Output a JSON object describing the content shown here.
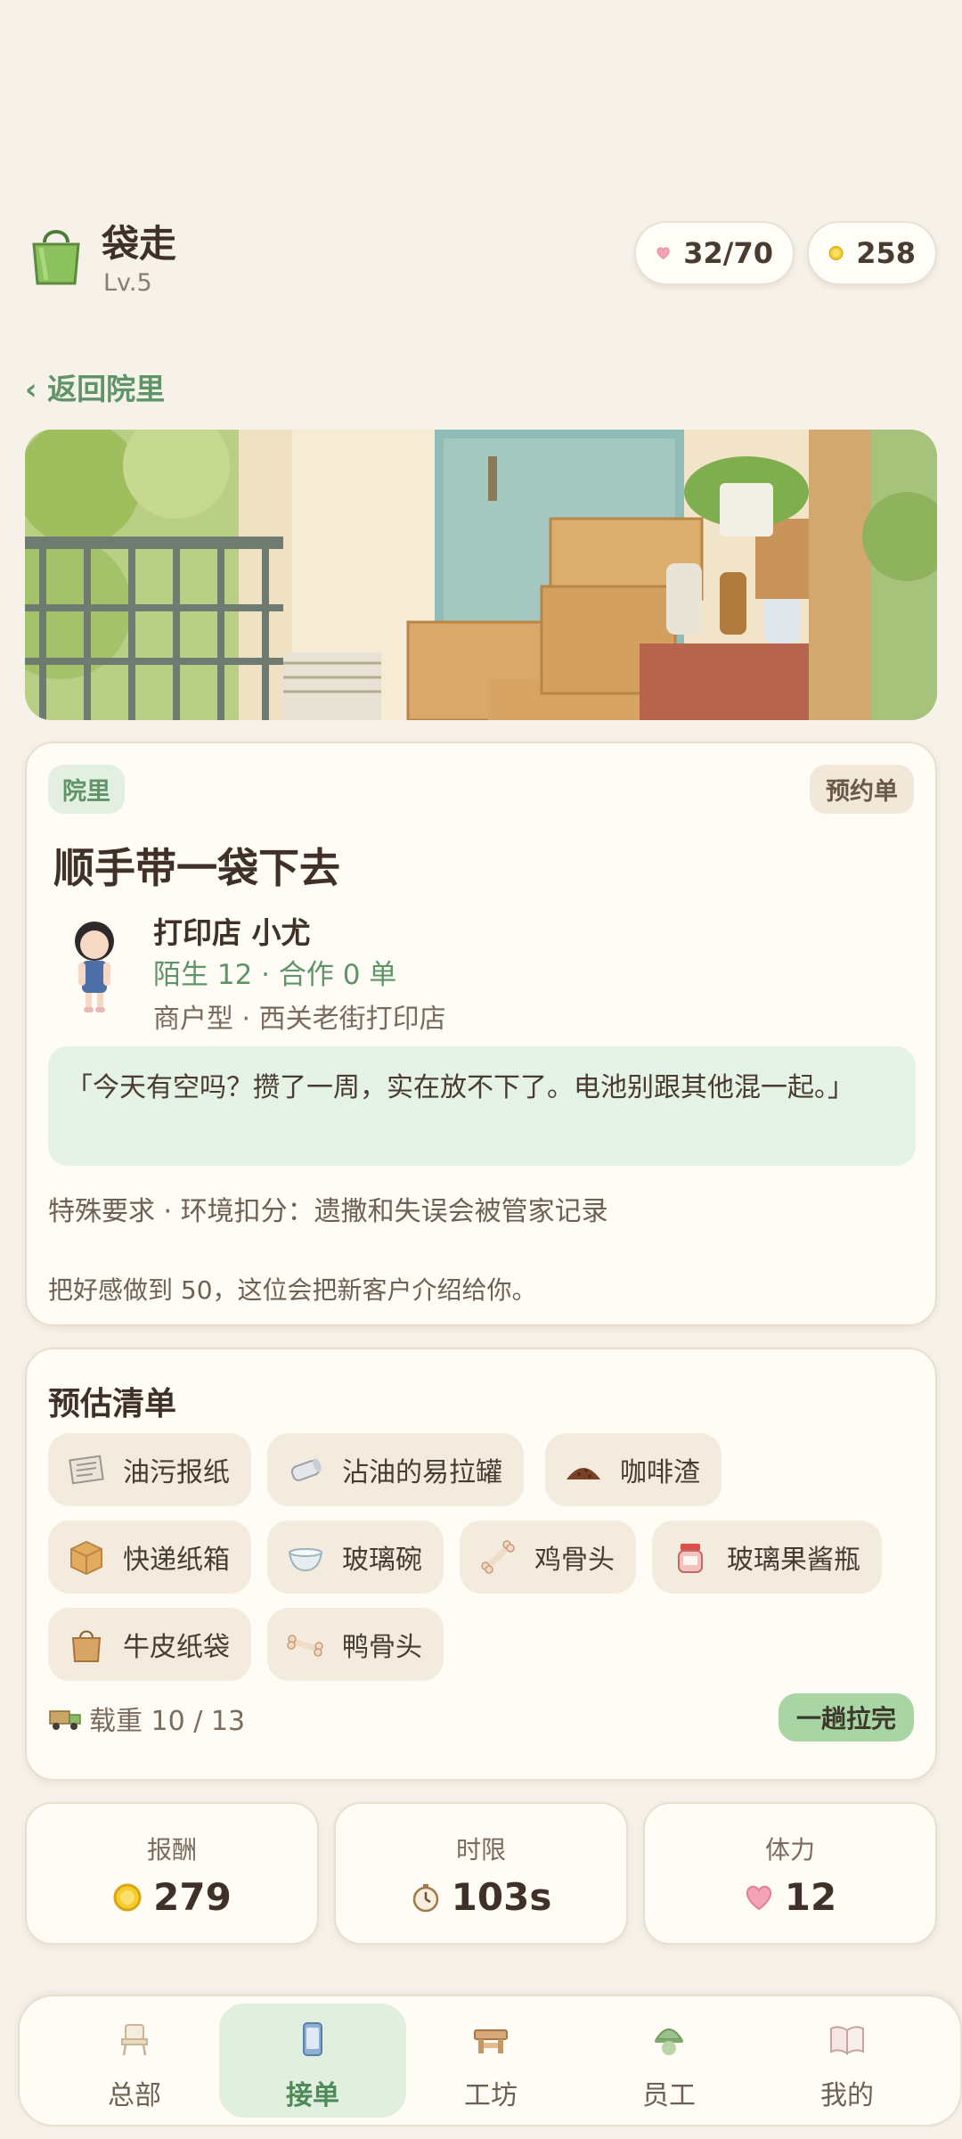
{
  "header": {
    "app_name": "袋走",
    "level": "Lv.5",
    "hearts": "32/70",
    "coins": "258"
  },
  "back_link": "‹ 返回院里",
  "order": {
    "location_tag": "院里",
    "type_tag": "预约单",
    "title": "顺手带一袋下去",
    "customer_name": "打印店 小尤",
    "relation": "陌生 12 · 合作 0 单",
    "customer_type": "商户型 · 西关老街打印店",
    "quote": "「今天有空吗？攒了一周，实在放不下了。电池别跟其他混一起。」",
    "requirement": "特殊要求 · 环境扣分：遗撒和失误会被管家记录",
    "hint": "把好感做到 50，这位会把新客户介绍给你。"
  },
  "list": {
    "title": "预估清单",
    "items": [
      {
        "label": "油污报纸",
        "icon": "newspaper-icon"
      },
      {
        "label": "沾油的易拉罐",
        "icon": "can-icon"
      },
      {
        "label": "咖啡渣",
        "icon": "coffee-grounds-icon"
      },
      {
        "label": "快递纸箱",
        "icon": "box-icon"
      },
      {
        "label": "玻璃碗",
        "icon": "glass-bowl-icon"
      },
      {
        "label": "鸡骨头",
        "icon": "bone-icon"
      },
      {
        "label": "玻璃果酱瓶",
        "icon": "jam-jar-icon"
      },
      {
        "label": "牛皮纸袋",
        "icon": "paper-bag-icon"
      },
      {
        "label": "鸭骨头",
        "icon": "bone-icon"
      }
    ],
    "load": "载重 10 / 13",
    "finish_button": "一趟拉完"
  },
  "stats": {
    "reward_label": "报酬",
    "reward_value": "279",
    "time_label": "时限",
    "time_value": "103s",
    "stamina_label": "体力",
    "stamina_value": "12"
  },
  "nav": {
    "items": [
      {
        "label": "总部",
        "icon": "chair-icon",
        "active": false
      },
      {
        "label": "接单",
        "icon": "phone-icon",
        "active": true
      },
      {
        "label": "工坊",
        "icon": "workbench-icon",
        "active": false
      },
      {
        "label": "员工",
        "icon": "staff-icon",
        "active": false
      },
      {
        "label": "我的",
        "icon": "book-icon",
        "active": false
      }
    ]
  },
  "colors": {
    "accent_green": "#5e9468",
    "background": "#f6f2ea",
    "card": "#fffcf6",
    "quote_bg": "#e5f2e6",
    "chip_bg": "#f3ebdd"
  }
}
